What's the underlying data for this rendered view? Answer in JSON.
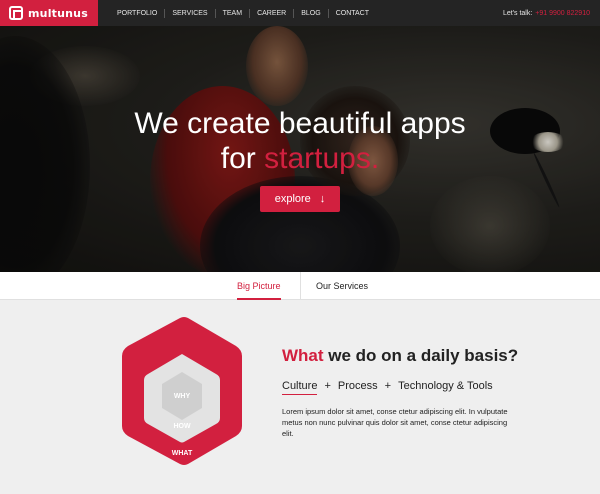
{
  "brand": {
    "name": "multunus",
    "color": "#d2203f"
  },
  "nav": {
    "items": [
      "PORTFOLIO",
      "SERVICES",
      "TEAM",
      "CAREER",
      "BLOG",
      "CONTACT"
    ]
  },
  "contact": {
    "label": "Let's talk:",
    "phone": "+91 9900 822910"
  },
  "hero": {
    "line1": "We create beautiful apps",
    "line2_prefix": "for ",
    "line2_accent": "startups.",
    "button_label": "explore",
    "button_icon": "arrow-down-icon"
  },
  "tabs": {
    "big_picture": "Big Picture",
    "our_services": "Our Services"
  },
  "content": {
    "title_accent": "What",
    "title_rest": " we do on a daily basis?",
    "nav": [
      "Culture",
      "Process",
      "Technology & Tools"
    ],
    "separator": "+",
    "body": "Lorem ipsum dolor sit amet, conse ctetur adipiscing elit. In vulputate metus non nunc pulvinar quis dolor sit amet, conse ctetur adipiscing elit."
  },
  "diagram": {
    "layers": [
      "WHY",
      "HOW",
      "WHAT"
    ]
  }
}
